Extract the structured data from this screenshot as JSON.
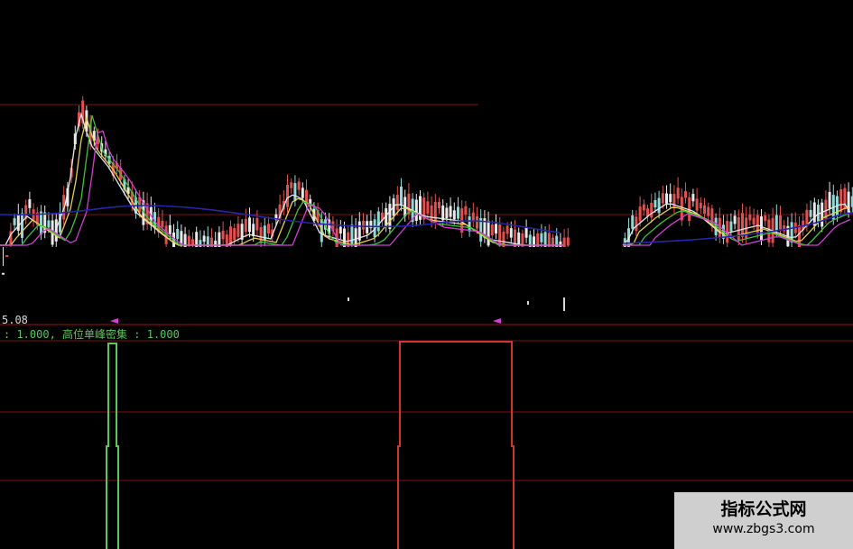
{
  "indicator": {
    "value_readout": "5.08",
    "legend_prefix": ": 1.000,",
    "legend_label": "高位单峰密集",
    "legend_value": ": 1.000"
  },
  "colors": {
    "background": "#000000",
    "grid": "#7a1414",
    "ma_blue": "#2626a8",
    "signal_green": "#58c858",
    "signal_red": "#d23232",
    "marker_magenta": "#d040d0"
  },
  "watermark": {
    "brand": "指标公式网",
    "url": "www.zbgs3.com"
  }
}
